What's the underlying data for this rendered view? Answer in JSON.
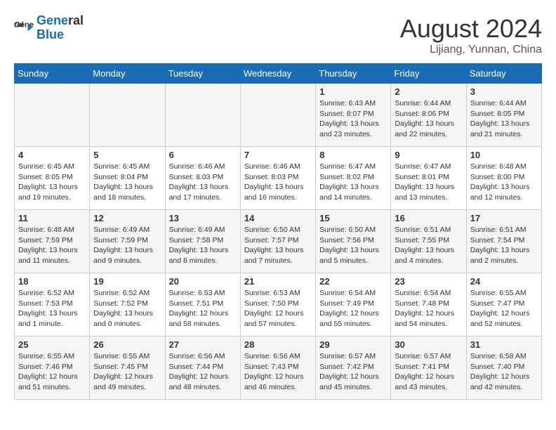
{
  "header": {
    "logo_line1": "General",
    "logo_line2": "Blue",
    "month_year": "August 2024",
    "location": "Lijiang, Yunnan, China"
  },
  "weekdays": [
    "Sunday",
    "Monday",
    "Tuesday",
    "Wednesday",
    "Thursday",
    "Friday",
    "Saturday"
  ],
  "weeks": [
    [
      {
        "day": "",
        "info": ""
      },
      {
        "day": "",
        "info": ""
      },
      {
        "day": "",
        "info": ""
      },
      {
        "day": "",
        "info": ""
      },
      {
        "day": "1",
        "info": "Sunrise: 6:43 AM\nSunset: 8:07 PM\nDaylight: 13 hours\nand 23 minutes."
      },
      {
        "day": "2",
        "info": "Sunrise: 6:44 AM\nSunset: 8:06 PM\nDaylight: 13 hours\nand 22 minutes."
      },
      {
        "day": "3",
        "info": "Sunrise: 6:44 AM\nSunset: 8:05 PM\nDaylight: 13 hours\nand 21 minutes."
      }
    ],
    [
      {
        "day": "4",
        "info": "Sunrise: 6:45 AM\nSunset: 8:05 PM\nDaylight: 13 hours\nand 19 minutes."
      },
      {
        "day": "5",
        "info": "Sunrise: 6:45 AM\nSunset: 8:04 PM\nDaylight: 13 hours\nand 18 minutes."
      },
      {
        "day": "6",
        "info": "Sunrise: 6:46 AM\nSunset: 8:03 PM\nDaylight: 13 hours\nand 17 minutes."
      },
      {
        "day": "7",
        "info": "Sunrise: 6:46 AM\nSunset: 8:03 PM\nDaylight: 13 hours\nand 16 minutes."
      },
      {
        "day": "8",
        "info": "Sunrise: 6:47 AM\nSunset: 8:02 PM\nDaylight: 13 hours\nand 14 minutes."
      },
      {
        "day": "9",
        "info": "Sunrise: 6:47 AM\nSunset: 8:01 PM\nDaylight: 13 hours\nand 13 minutes."
      },
      {
        "day": "10",
        "info": "Sunrise: 6:48 AM\nSunset: 8:00 PM\nDaylight: 13 hours\nand 12 minutes."
      }
    ],
    [
      {
        "day": "11",
        "info": "Sunrise: 6:48 AM\nSunset: 7:59 PM\nDaylight: 13 hours\nand 11 minutes."
      },
      {
        "day": "12",
        "info": "Sunrise: 6:49 AM\nSunset: 7:59 PM\nDaylight: 13 hours\nand 9 minutes."
      },
      {
        "day": "13",
        "info": "Sunrise: 6:49 AM\nSunset: 7:58 PM\nDaylight: 13 hours\nand 8 minutes."
      },
      {
        "day": "14",
        "info": "Sunrise: 6:50 AM\nSunset: 7:57 PM\nDaylight: 13 hours\nand 7 minutes."
      },
      {
        "day": "15",
        "info": "Sunrise: 6:50 AM\nSunset: 7:56 PM\nDaylight: 13 hours\nand 5 minutes."
      },
      {
        "day": "16",
        "info": "Sunrise: 6:51 AM\nSunset: 7:55 PM\nDaylight: 13 hours\nand 4 minutes."
      },
      {
        "day": "17",
        "info": "Sunrise: 6:51 AM\nSunset: 7:54 PM\nDaylight: 13 hours\nand 2 minutes."
      }
    ],
    [
      {
        "day": "18",
        "info": "Sunrise: 6:52 AM\nSunset: 7:53 PM\nDaylight: 13 hours\nand 1 minute."
      },
      {
        "day": "19",
        "info": "Sunrise: 6:52 AM\nSunset: 7:52 PM\nDaylight: 13 hours\nand 0 minutes."
      },
      {
        "day": "20",
        "info": "Sunrise: 6:53 AM\nSunset: 7:51 PM\nDaylight: 12 hours\nand 58 minutes."
      },
      {
        "day": "21",
        "info": "Sunrise: 6:53 AM\nSunset: 7:50 PM\nDaylight: 12 hours\nand 57 minutes."
      },
      {
        "day": "22",
        "info": "Sunrise: 6:54 AM\nSunset: 7:49 PM\nDaylight: 12 hours\nand 55 minutes."
      },
      {
        "day": "23",
        "info": "Sunrise: 6:54 AM\nSunset: 7:48 PM\nDaylight: 12 hours\nand 54 minutes."
      },
      {
        "day": "24",
        "info": "Sunrise: 6:55 AM\nSunset: 7:47 PM\nDaylight: 12 hours\nand 52 minutes."
      }
    ],
    [
      {
        "day": "25",
        "info": "Sunrise: 6:55 AM\nSunset: 7:46 PM\nDaylight: 12 hours\nand 51 minutes."
      },
      {
        "day": "26",
        "info": "Sunrise: 6:55 AM\nSunset: 7:45 PM\nDaylight: 12 hours\nand 49 minutes."
      },
      {
        "day": "27",
        "info": "Sunrise: 6:56 AM\nSunset: 7:44 PM\nDaylight: 12 hours\nand 48 minutes."
      },
      {
        "day": "28",
        "info": "Sunrise: 6:56 AM\nSunset: 7:43 PM\nDaylight: 12 hours\nand 46 minutes."
      },
      {
        "day": "29",
        "info": "Sunrise: 6:57 AM\nSunset: 7:42 PM\nDaylight: 12 hours\nand 45 minutes."
      },
      {
        "day": "30",
        "info": "Sunrise: 6:57 AM\nSunset: 7:41 PM\nDaylight: 12 hours\nand 43 minutes."
      },
      {
        "day": "31",
        "info": "Sunrise: 6:58 AM\nSunset: 7:40 PM\nDaylight: 12 hours\nand 42 minutes."
      }
    ]
  ]
}
